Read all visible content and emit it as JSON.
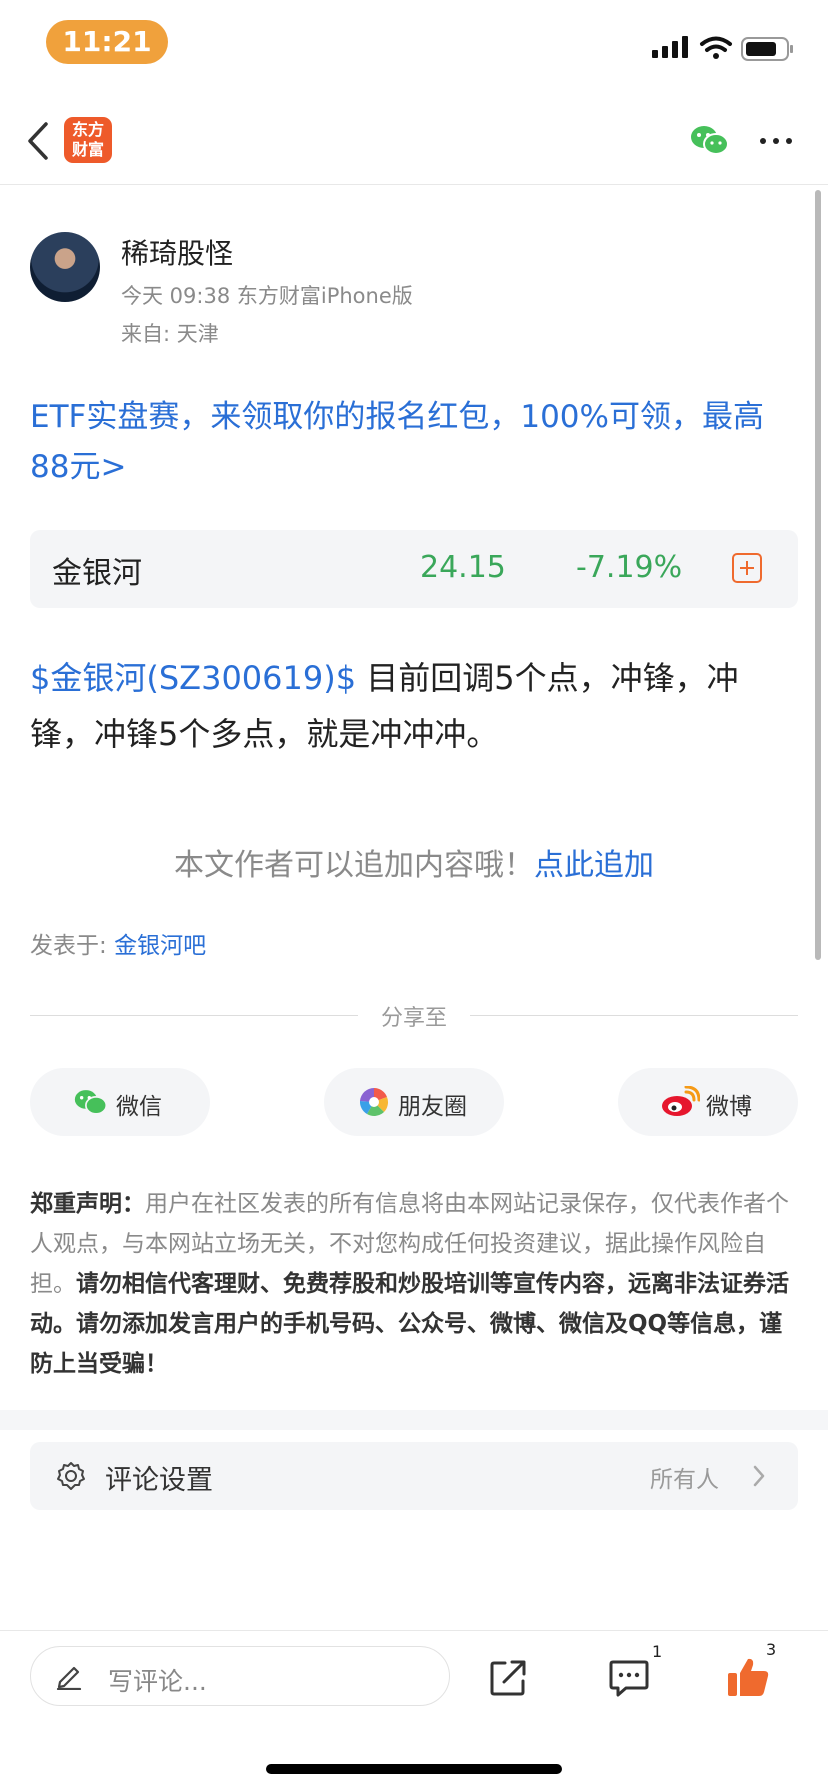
{
  "status_bar": {
    "time": "11:21"
  },
  "nav": {
    "logo_text": "东方\n财富",
    "back_icon": "chevron-left-icon",
    "wechat_icon": "wechat-icon",
    "more_icon": "more-icon"
  },
  "author": {
    "name": "稀琦股怪",
    "post_meta": "今天 09:38 东方财富iPhone版",
    "location": "来自: 天津"
  },
  "promo_link": "ETF实盘赛，来领取你的报名红包，100%可领，最高88元>",
  "stock_card": {
    "name": "金银河",
    "price": "24.15",
    "change": "-7.19%",
    "add_icon": "plus-square-icon",
    "color": "#3aa75a"
  },
  "post": {
    "tag": "$金银河(SZ300619)$",
    "text": " 目前回调5个点，冲锋，冲锋，冲锋5个多点，就是冲冲冲。"
  },
  "append": {
    "prompt": "本文作者可以追加内容哦！",
    "link": "点此追加"
  },
  "posted_in": {
    "label": "发表于: ",
    "forum": "金银河吧"
  },
  "share": {
    "title": "分享至",
    "buttons": [
      {
        "label": "微信",
        "icon": "wechat-icon"
      },
      {
        "label": "朋友圈",
        "icon": "moments-icon"
      },
      {
        "label": "微博",
        "icon": "weibo-icon"
      }
    ]
  },
  "disclaimer": {
    "heading": "郑重声明：",
    "normal": "用户在社区发表的所有信息将由本网站记录保存，仅代表作者个人观点，与本网站立场无关，不对您构成任何投资建议，据此操作风险自担。",
    "bold": "请勿相信代客理财、免费荐股和炒股培训等宣传内容，远离非法证券活动。请勿添加发言用户的手机号码、公众号、微博、微信及QQ等信息，谨防上当受骗！"
  },
  "comment_settings": {
    "label": "评论设置",
    "value": "所有人",
    "icon": "gear-icon"
  },
  "bottom_bar": {
    "placeholder": "写评论...",
    "comment_count": "1",
    "like_count": "3",
    "accent": "#ef6a2e"
  }
}
